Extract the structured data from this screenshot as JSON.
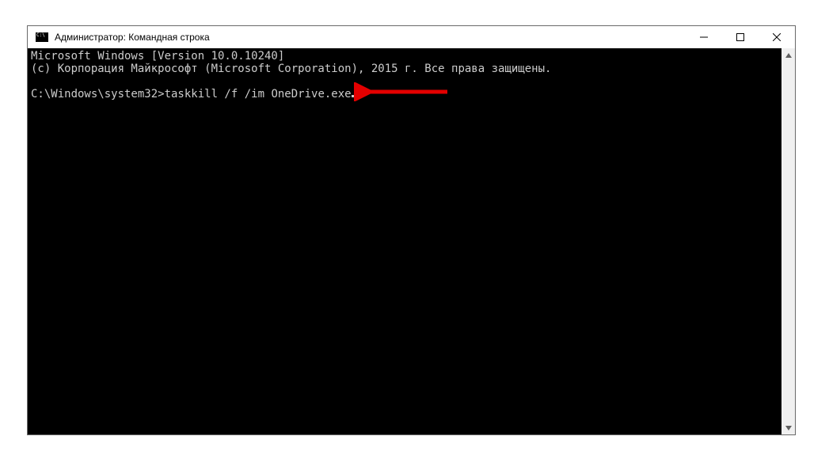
{
  "window": {
    "title": "Администратор: Командная строка"
  },
  "terminal": {
    "line1": "Microsoft Windows [Version 10.0.10240]",
    "line2": "(c) Корпорация Майкрософт (Microsoft Corporation), 2015 г. Все права защищены.",
    "blank": "",
    "prompt": "C:\\Windows\\system32>",
    "command": "taskkill /f /im OneDrive.exe"
  },
  "icons": {
    "app": "cmd-icon",
    "minimize": "minimize-icon",
    "maximize": "maximize-icon",
    "close": "close-icon",
    "scroll_up": "scroll-up-icon",
    "scroll_down": "scroll-down-icon"
  }
}
